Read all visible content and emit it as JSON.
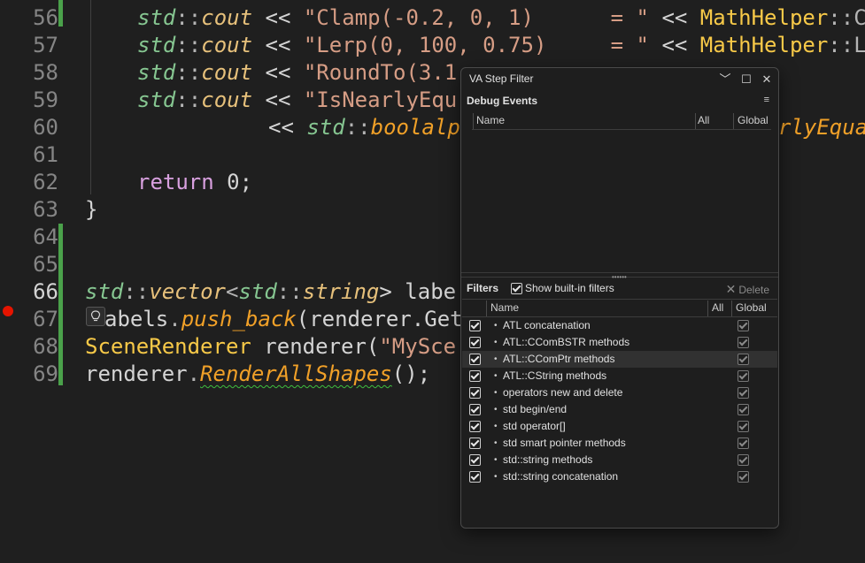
{
  "editor": {
    "line_numbers": [
      "56",
      "57",
      "58",
      "59",
      "60",
      "61",
      "62",
      "63",
      "64",
      "65",
      "66",
      "67",
      "68",
      "69"
    ],
    "current_line": "66",
    "lines": {
      "l56": {
        "a": "std",
        "b": "::",
        "c": "cout",
        "d": " << ",
        "e": "\"Clamp(-0.2, 0, 1)      = \"",
        "f": " << ",
        "g": "MathHelper",
        "h": "::C"
      },
      "l57": {
        "a": "std",
        "b": "::",
        "c": "cout",
        "d": " << ",
        "e": "\"Lerp(0, 100, 0.75)     = \"",
        "f": " << ",
        "g": "MathHelper",
        "h": "::L"
      },
      "l58": {
        "a": "std",
        "b": "::",
        "c": "cout",
        "d": " << ",
        "e": "\"RoundTo(3.1"
      },
      "l59": {
        "a": "std",
        "b": "::",
        "c": "cout",
        "d": " << ",
        "e": "\"IsNearlyEqu"
      },
      "l60": {
        "a": "<< ",
        "b": "std",
        "c": "::",
        "d": "boolalp",
        "e": "rlyEqual"
      },
      "l62": {
        "a": "return",
        "b": " 0;"
      },
      "l63": {
        "a": "}"
      },
      "l66": {
        "a": "std",
        "b": "::",
        "c": "vector",
        "d": "<",
        "e": "std",
        "f": "::",
        "g": "string",
        "h": "> labe"
      },
      "l67": {
        "a": "abels",
        "b": ".",
        "c": "push_back",
        "d": "(",
        "e": "renderer",
        "f": ".Get"
      },
      "l68": {
        "a": "SceneRenderer",
        "b": " renderer(",
        "c": "\"MySce"
      },
      "l69": {
        "a": "renderer",
        "b": ".",
        "c": "RenderAllShapes",
        "d": "();"
      }
    },
    "lightbulb_icon": "lightbulb-icon"
  },
  "panel": {
    "title": "VA Step Filter",
    "window_controls": {
      "chevron": "﹀",
      "maximize": "☐",
      "close": "✕"
    },
    "debug_events": {
      "label": "Debug Events",
      "menu_icon": "≡",
      "columns": {
        "name": "Name",
        "all": "All",
        "global": "Global"
      }
    },
    "filters": {
      "label": "Filters",
      "show_builtin_label": "Show built-in filters",
      "delete_label": "Delete",
      "columns": {
        "name": "Name",
        "all": "All",
        "global": "Global"
      },
      "items": [
        {
          "name": "ATL concatenation"
        },
        {
          "name": "ATL::CComBSTR methods"
        },
        {
          "name": "ATL::CComPtr methods"
        },
        {
          "name": "ATL::CString methods"
        },
        {
          "name": "operators new and delete"
        },
        {
          "name": "std begin/end"
        },
        {
          "name": "std operator[]"
        },
        {
          "name": "std smart pointer methods"
        },
        {
          "name": "std::string methods"
        },
        {
          "name": "std::string concatenation"
        }
      ],
      "selected_index": 2
    }
  }
}
